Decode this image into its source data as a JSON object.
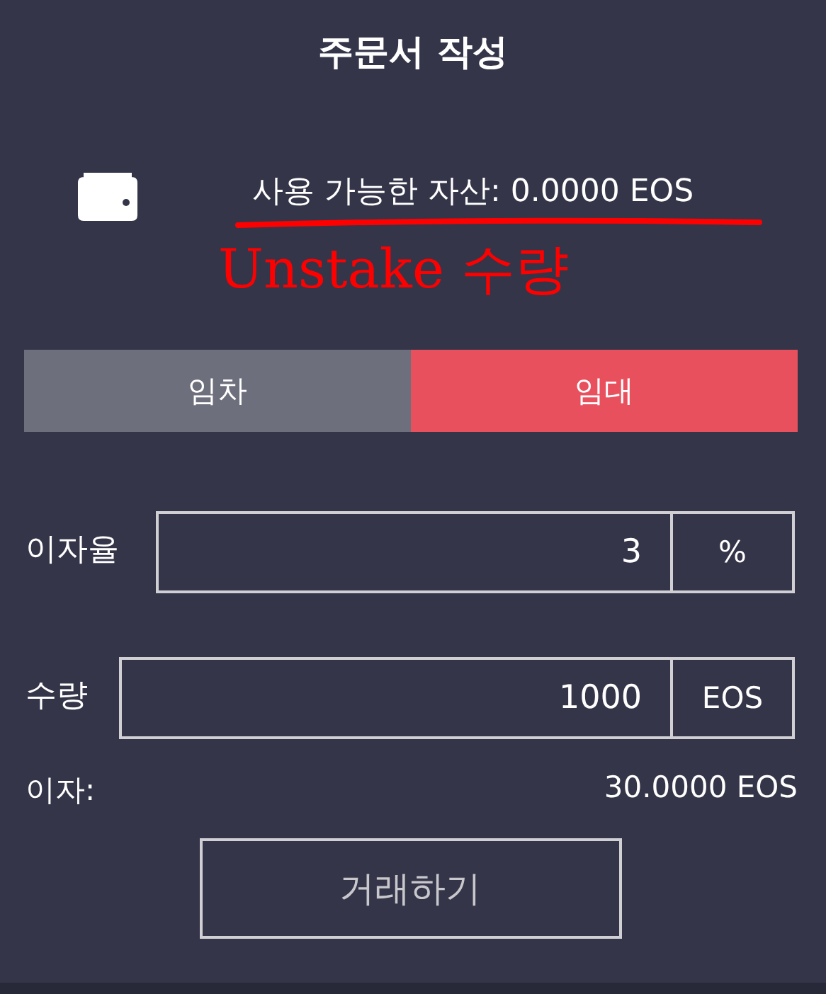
{
  "title": "주문서 작성",
  "balance": {
    "text": "사용 가능한 자산: 0.0000 EOS"
  },
  "annotation": {
    "text": "Unstake 수량"
  },
  "tabs": [
    {
      "label": "임차",
      "selected": false
    },
    {
      "label": "임대",
      "selected": true
    }
  ],
  "fields": [
    {
      "label": "이자율",
      "value": "3",
      "unit": "%"
    },
    {
      "label": "수량",
      "value": "1000",
      "unit": "EOS"
    }
  ],
  "interest": {
    "label": "이자:",
    "value": "30.0000 EOS"
  },
  "submit_button": "거래하기"
}
